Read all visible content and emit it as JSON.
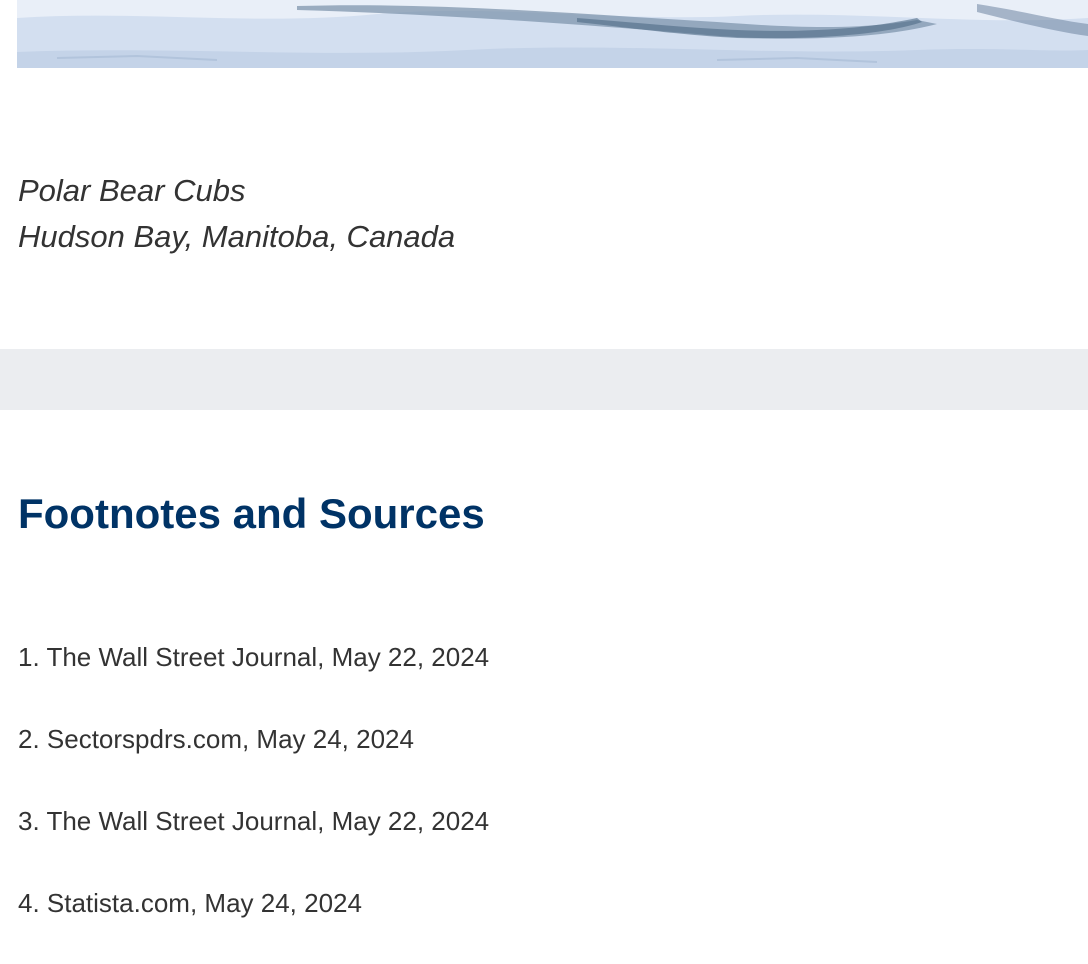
{
  "photo": {
    "caption_line1": "Polar Bear Cubs",
    "caption_line2": "Hudson Bay, Manitoba, Canada"
  },
  "footnotes": {
    "title": "Footnotes and Sources",
    "items": [
      "1. The Wall Street Journal, May 22, 2024",
      "2. Sectorspdrs.com, May 24, 2024",
      "3. The Wall Street Journal, May 22, 2024",
      "4. Statista.com, May 24, 2024"
    ]
  },
  "colors": {
    "title": "#003366",
    "text": "#333333",
    "band": "#ebedf0",
    "ice": "#d6e2f2"
  }
}
